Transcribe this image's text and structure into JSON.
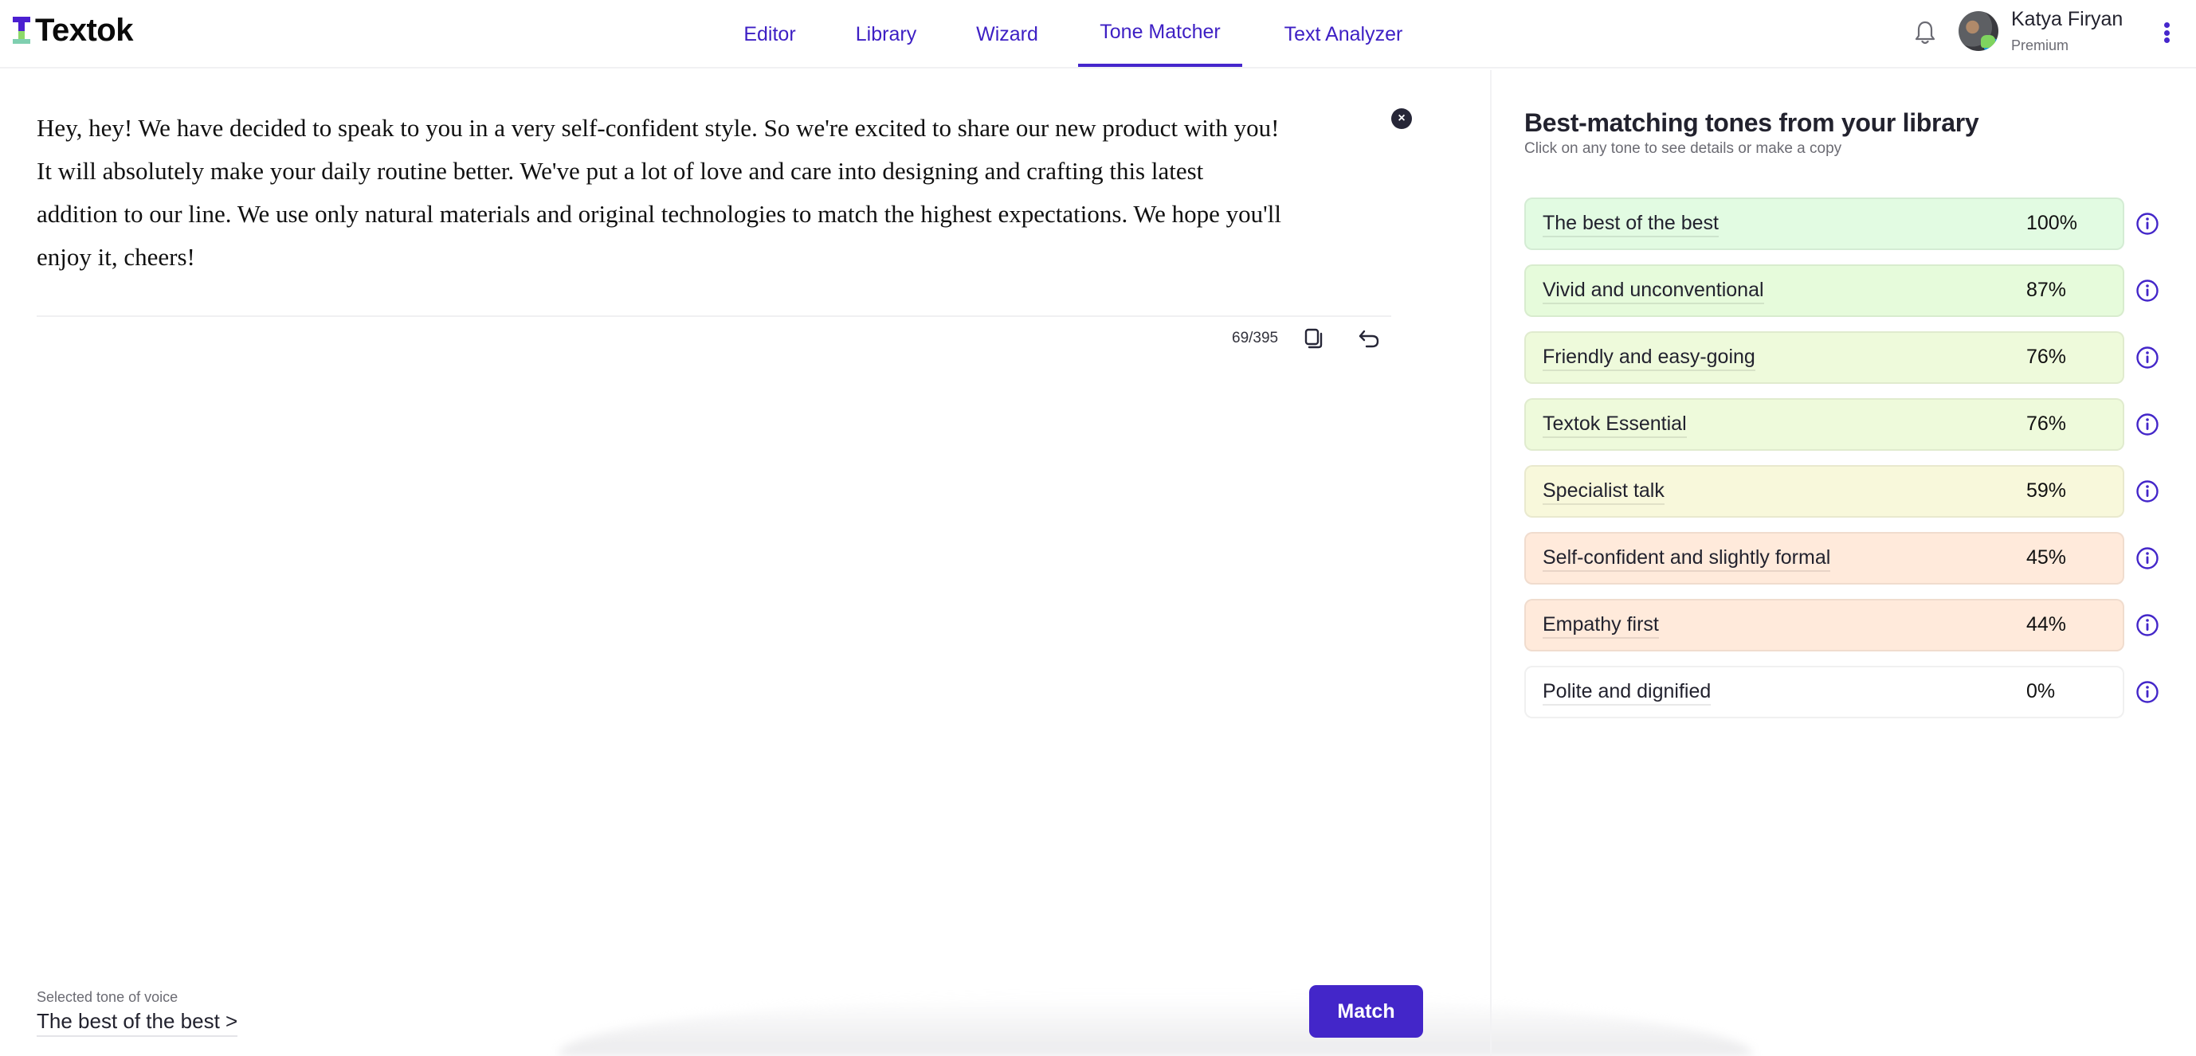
{
  "app": {
    "name": "Textok"
  },
  "nav": {
    "items": [
      {
        "label": "Editor",
        "active": false
      },
      {
        "label": "Library",
        "active": false
      },
      {
        "label": "Wizard",
        "active": false
      },
      {
        "label": "Tone Matcher",
        "active": true
      },
      {
        "label": "Text Analyzer",
        "active": false
      }
    ]
  },
  "user": {
    "name": "Katya Firyan",
    "plan": "Premium",
    "icons": {
      "notifications": "bell-icon",
      "menu": "kebab-menu-icon"
    }
  },
  "editor": {
    "text": "Hey, hey! We have decided to speak to you in a very self-confident style. So we're excited to share our new product with you! It will absolutely make your daily routine better. We've put a lot of love and care into designing and crafting this latest addition to our line. We use only natural materials and original technologies to match the highest expectations. We hope you'll enjoy it, cheers!",
    "lines": [
      "Hey, hey! We have decided to speak to you in a very self-confident style. So we're excited to share our new product with you!",
      "It will absolutely make your daily routine better. We've put a lot of love and care into designing and crafting this latest",
      "addition to our line. We use only natural materials and original technologies to match the highest expectations. We hope you'll",
      "enjoy it, cheers!"
    ],
    "clear_symbol": "×",
    "counter": "69/395",
    "icons": {
      "clear": "close-circle-icon",
      "copy": "copy-icon",
      "undo": "undo-icon"
    }
  },
  "footer": {
    "selected_label": "Selected tone of voice",
    "selected_value": "The best of the best >",
    "match_label": "Match"
  },
  "panel": {
    "title": "Best-matching tones from your library",
    "subtitle": "Click on any tone to see details or make a copy",
    "tones": [
      {
        "name": "The best of the best",
        "score": "100%",
        "value": 100,
        "color": "#e2fbe2"
      },
      {
        "name": "Vivid and unconventional",
        "score": "87%",
        "value": 87,
        "color": "#e6fbdb"
      },
      {
        "name": "Friendly and easy-going",
        "score": "76%",
        "value": 76,
        "color": "#eefadb"
      },
      {
        "name": "Textok Essential",
        "score": "76%",
        "value": 76,
        "color": "#eefadb"
      },
      {
        "name": "Specialist talk",
        "score": "59%",
        "value": 59,
        "color": "#f8f8db"
      },
      {
        "name": "Self-confident and slightly formal",
        "score": "45%",
        "value": 45,
        "color": "#ffeadb"
      },
      {
        "name": "Empathy first",
        "score": "44%",
        "value": 44,
        "color": "#ffeadb"
      },
      {
        "name": "Polite and dignified",
        "score": "0%",
        "value": 0,
        "color": "#ffffff"
      }
    ]
  },
  "colors": {
    "accent": "#4326c9",
    "text": "#22222e",
    "muted": "#6b6b73"
  }
}
